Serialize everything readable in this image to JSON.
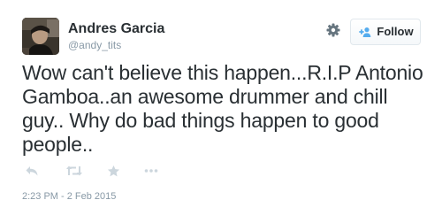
{
  "user": {
    "name": "Andres Garcia",
    "handle": "@andy_tits"
  },
  "header": {
    "follow_label": "Follow",
    "settings_icon": "gear-icon",
    "follow_icon": "follow-user-icon"
  },
  "tweet": {
    "text": "Wow can't believe this happen...R.I.P Antonio Gamboa..an awesome drummer and chill guy.. Why do bad things happen to good people..",
    "timestamp": "2:23 PM - 2 Feb 2015"
  },
  "actions": {
    "icons": [
      "reply-icon",
      "retweet-icon",
      "favorite-icon",
      "more-icon"
    ]
  },
  "colors": {
    "text": "#292f33",
    "muted": "#8899a6",
    "icon": "#ccd6dd",
    "accent": "#55acee",
    "border": "#e1e8ed"
  }
}
